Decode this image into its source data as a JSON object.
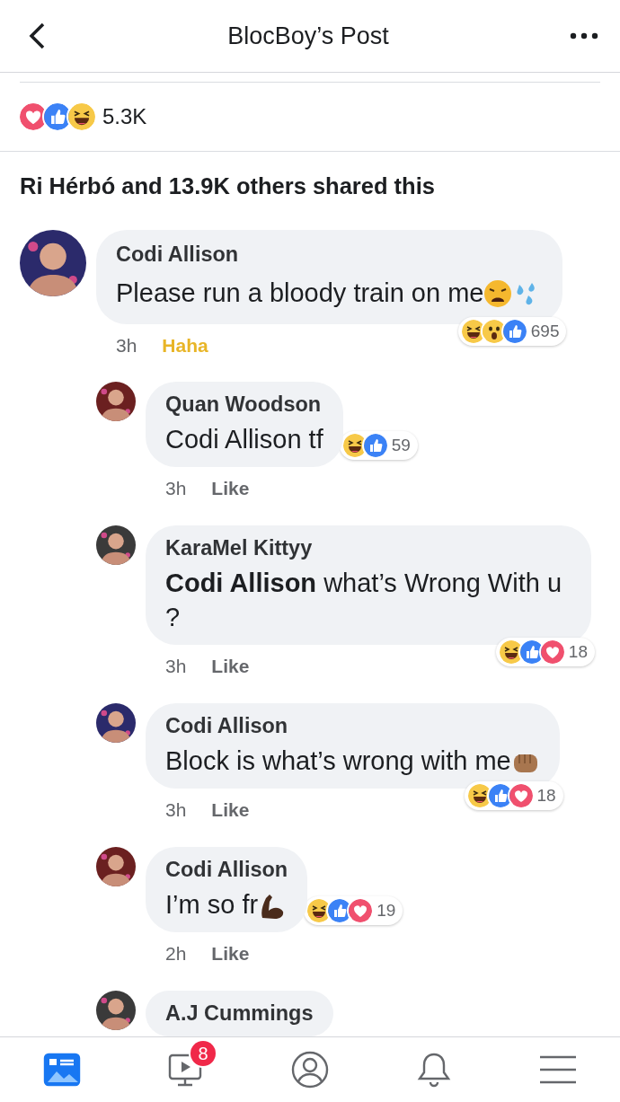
{
  "header": {
    "title": "BlocBoy’s Post"
  },
  "reactions_summary": {
    "reactions": [
      {
        "kind": "love"
      },
      {
        "kind": "like"
      },
      {
        "kind": "haha"
      }
    ],
    "count": "5.3K"
  },
  "shared_text": "Ri Hérbó and 13.9K others shared this",
  "comments": [
    {
      "author": "Codi Allison",
      "text": "Please run a bloody train on me",
      "emoji": [
        {
          "kind": "weary"
        },
        {
          "kind": "droplets"
        }
      ],
      "time": "3h",
      "action": {
        "label": "Haha",
        "selected": true
      },
      "reactions": {
        "kind": "overlap",
        "items": [
          {
            "kind": "haha"
          },
          {
            "kind": "wow"
          },
          {
            "kind": "like"
          }
        ],
        "count": "695"
      },
      "children": [
        {
          "author": "Quan Woodson",
          "text": "Codi Allison tf",
          "time": "3h",
          "action": {
            "label": "Like",
            "selected": false
          },
          "reactions": {
            "kind": "inline",
            "items": [
              {
                "kind": "haha"
              },
              {
                "kind": "like"
              }
            ],
            "count": "59"
          }
        },
        {
          "author": "KaraMel Kittyy",
          "text": "**Codi Allison** what’s Wrong With u ?",
          "time": "3h",
          "action": {
            "label": "Like",
            "selected": false
          },
          "reactions": {
            "kind": "overlap",
            "items": [
              {
                "kind": "haha"
              },
              {
                "kind": "like"
              },
              {
                "kind": "love"
              }
            ],
            "count": "18"
          }
        },
        {
          "author": "Codi Allison",
          "text": "Block is what’s wrong with me",
          "emoji": [
            {
              "kind": "fist"
            }
          ],
          "time": "3h",
          "action": {
            "label": "Like",
            "selected": false
          },
          "reactions": {
            "kind": "overlap",
            "items": [
              {
                "kind": "haha"
              },
              {
                "kind": "like"
              },
              {
                "kind": "love"
              }
            ],
            "count": "18"
          }
        },
        {
          "author": "Codi Allison",
          "text": "I’m so fr",
          "emoji": [
            {
              "kind": "flexed-arm"
            }
          ],
          "time": "2h",
          "action": {
            "label": "Like",
            "selected": false
          },
          "reactions": {
            "kind": "inline",
            "items": [
              {
                "kind": "haha"
              },
              {
                "kind": "like"
              },
              {
                "kind": "love"
              }
            ],
            "count": "19"
          }
        },
        {
          "author": "A.J Cummings"
        }
      ]
    }
  ],
  "tab_bar": [
    {
      "kind": "feed",
      "selected": true
    },
    {
      "kind": "video",
      "selected": false,
      "badge": "8"
    },
    {
      "kind": "profile",
      "selected": false
    },
    {
      "kind": "notifications",
      "selected": false
    },
    {
      "kind": "menu",
      "selected": false
    }
  ]
}
